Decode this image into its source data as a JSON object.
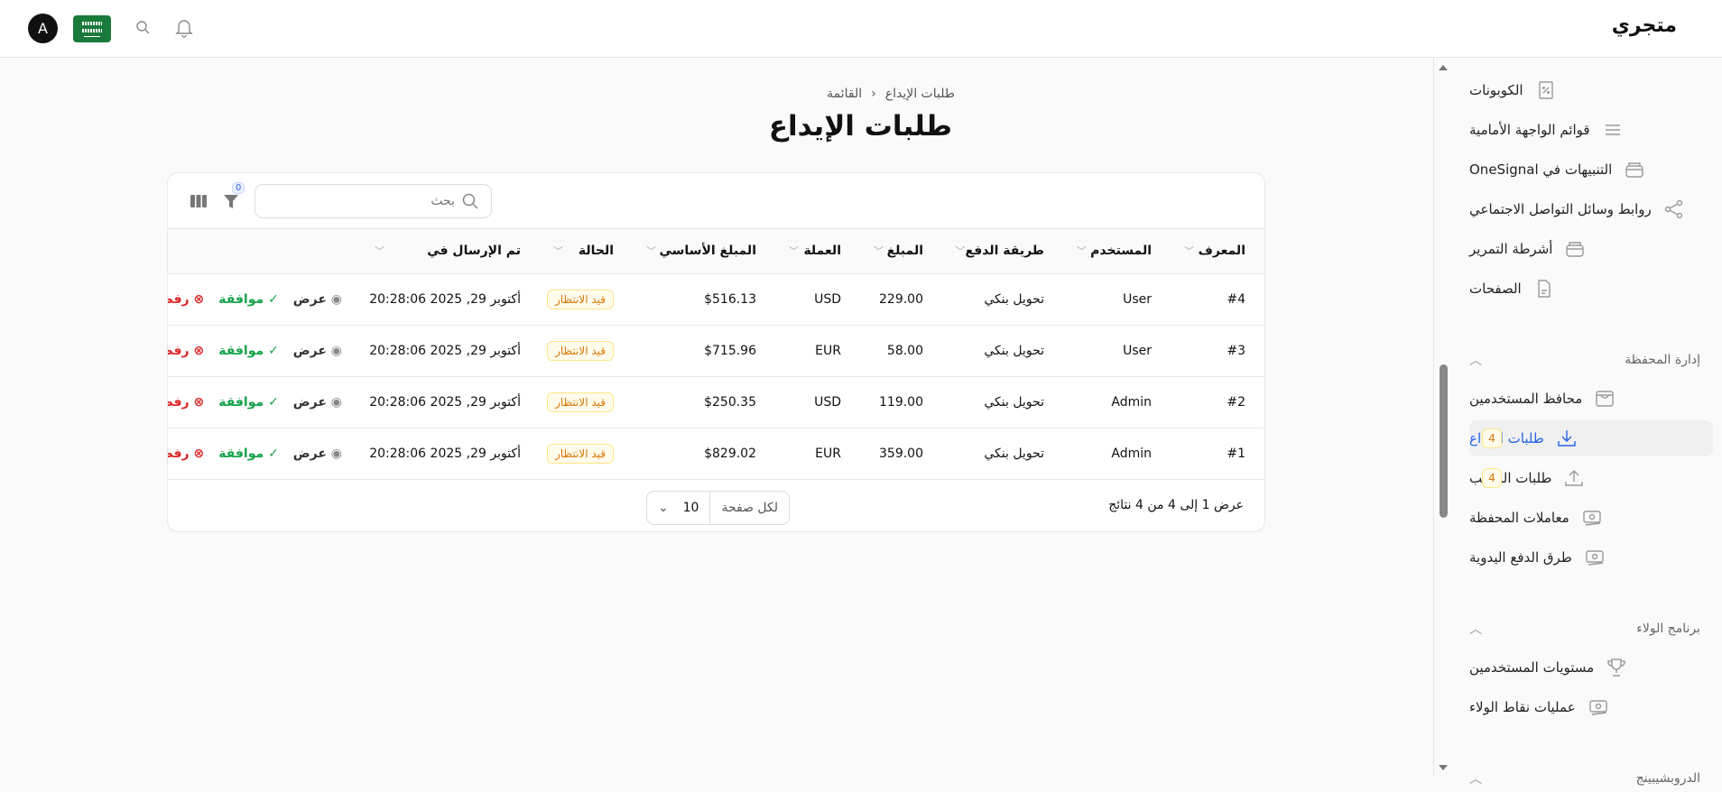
{
  "header": {
    "logo": "متجري",
    "avatar_letter": "A",
    "icons": [
      "bell-icon",
      "search-icon",
      "saudi-flag",
      "avatar"
    ]
  },
  "sidebar": {
    "items_top": [
      {
        "label": "الكوبونات",
        "icon": "coupon-icon"
      },
      {
        "label": "قوائم الواجهة الأمامية",
        "icon": "menu-icon"
      },
      {
        "label": "التنبيهات في OneSignal",
        "icon": "inbox-icon"
      },
      {
        "label": "روابط وسائل التواصل الاجتماعي",
        "icon": "share-icon"
      },
      {
        "label": "أشرطة التمرير",
        "icon": "inbox-icon"
      },
      {
        "label": "الصفحات",
        "icon": "document-icon"
      }
    ],
    "groups": [
      {
        "label": "إدارة المحفظة",
        "items": [
          {
            "label": "محافظ المستخدمين",
            "icon": "wallet-icon"
          },
          {
            "label": "طلبات الإيداع",
            "icon": "download-icon",
            "badge": "4",
            "active": true
          },
          {
            "label": "طلبات السحب",
            "icon": "upload-icon",
            "badge": "4"
          },
          {
            "label": "معاملات المحفظة",
            "icon": "cash-icon"
          },
          {
            "label": "طرق الدفع اليدوية",
            "icon": "cash-icon"
          }
        ]
      },
      {
        "label": "برنامج الولاء",
        "items": [
          {
            "label": "مستويات المستخدمين",
            "icon": "trophy-icon"
          },
          {
            "label": "عمليات نقاط الولاء",
            "icon": "cash-icon"
          }
        ]
      },
      {
        "label": "الدروبشيبينج",
        "items": []
      }
    ]
  },
  "breadcrumb": [
    "طلبات الإيداع",
    "القائمة"
  ],
  "page_title": "طلبات الإيداع",
  "toolbar": {
    "search_placeholder": "بحث",
    "filter_count": "0"
  },
  "table": {
    "columns": [
      "المعرف",
      "المستخدم",
      "طريقة الدفع",
      "المبلغ",
      "العملة",
      "المبلغ الأساسي",
      "الحالة",
      "تم الإرسال في"
    ],
    "rows": [
      {
        "id": "#4",
        "user": "User",
        "method": "تحويل بنكي",
        "amount": "229.00",
        "currency": "USD",
        "base": "$516.13",
        "status": "قيد الانتظار",
        "sent": "أكتوبر 29, 2025 20:28:06"
      },
      {
        "id": "#3",
        "user": "User",
        "method": "تحويل بنكي",
        "amount": "58.00",
        "currency": "EUR",
        "base": "$715.96",
        "status": "قيد الانتظار",
        "sent": "أكتوبر 29, 2025 20:28:06"
      },
      {
        "id": "#2",
        "user": "Admin",
        "method": "تحويل بنكي",
        "amount": "119.00",
        "currency": "USD",
        "base": "$250.35",
        "status": "قيد الانتظار",
        "sent": "أكتوبر 29, 2025 20:28:06"
      },
      {
        "id": "#1",
        "user": "Admin",
        "method": "تحويل بنكي",
        "amount": "359.00",
        "currency": "EUR",
        "base": "$829.02",
        "status": "قيد الانتظار",
        "sent": "أكتوبر 29, 2025 20:28:06"
      }
    ],
    "actions": {
      "view": "عرض",
      "approve": "موافقة",
      "reject": "رفض"
    }
  },
  "footer": {
    "summary": "عرض 1 إلى 4 من 4 نتائج",
    "per_page_label": "لكل صفحة",
    "per_page_value": "10"
  },
  "colors": {
    "accent": "#2563eb",
    "approve": "#16a34a",
    "reject": "#dc2626",
    "pending": "#d97706"
  }
}
